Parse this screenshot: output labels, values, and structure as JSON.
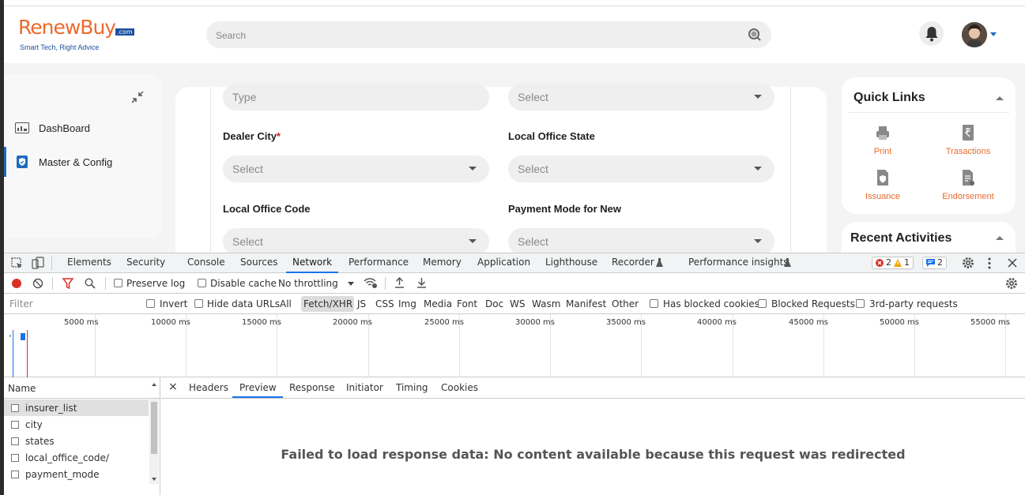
{
  "header": {
    "logo_main": "RenewBuy",
    "logo_dotcom": ".com",
    "logo_tagline": "Smart Tech, Right Advice",
    "search_placeholder": "Search",
    "brand_orange": "#ec6a2c",
    "brand_blue": "#1c4f9c"
  },
  "sidebar": {
    "items": [
      {
        "label": "DashBoard",
        "icon": "dashboard-icon"
      },
      {
        "label": "Master & Config",
        "icon": "shield-check-icon",
        "active": true
      }
    ]
  },
  "form": {
    "row1": {
      "left_placeholder": "Type",
      "right_placeholder": "Select"
    },
    "dealer_city_label": "Dealer City",
    "dealer_city_required": "*",
    "local_office_state_label": "Local Office State",
    "dealer_city_placeholder": "Select",
    "local_office_state_placeholder": "Select",
    "local_office_code_label": "Local Office Code",
    "payment_mode_label": "Payment Mode for New",
    "local_office_code_placeholder": "Select",
    "payment_mode_placeholder": "Select"
  },
  "quick_links": {
    "title": "Quick Links",
    "items": [
      {
        "label": "Print",
        "icon": "printer-icon"
      },
      {
        "label": "Trasactions",
        "icon": "rupee-document-icon"
      },
      {
        "label": "Issuance",
        "icon": "shield-document-icon"
      },
      {
        "label": "Endorsement",
        "icon": "edit-document-icon"
      }
    ]
  },
  "recent_activities": {
    "title": "Recent Activities"
  },
  "devtools": {
    "tabs": [
      "Elements",
      "Security",
      "Console",
      "Sources",
      "Network",
      "Performance",
      "Memory",
      "Application",
      "Lighthouse",
      "Recorder",
      "Performance insights"
    ],
    "active_tab": "Network",
    "errors": "2",
    "warnings": "1",
    "messages": "2",
    "toolbar": {
      "preserve_log": "Preserve log",
      "disable_cache": "Disable cache",
      "throttling": "No throttling"
    },
    "filter_bar": {
      "filter_placeholder": "Filter",
      "invert": "Invert",
      "hide_data_urls": "Hide data URLs",
      "types": [
        "All",
        "Fetch/XHR",
        "JS",
        "CSS",
        "Img",
        "Media",
        "Font",
        "Doc",
        "WS",
        "Wasm",
        "Manifest",
        "Other"
      ],
      "active_type": "Fetch/XHR",
      "has_blocked_cookies": "Has blocked cookies",
      "blocked_requests": "Blocked Requests",
      "third_party": "3rd-party requests"
    },
    "timeline_ticks": [
      "5000 ms",
      "10000 ms",
      "15000 ms",
      "20000 ms",
      "25000 ms",
      "30000 ms",
      "35000 ms",
      "40000 ms",
      "45000 ms",
      "50000 ms",
      "55000 ms"
    ],
    "requests": {
      "header": "Name",
      "rows": [
        "insurer_list",
        "city",
        "states",
        "local_office_code/",
        "payment_mode"
      ],
      "selected": "insurer_list"
    },
    "detail": {
      "close": "×",
      "tabs": [
        "Headers",
        "Preview",
        "Response",
        "Initiator",
        "Timing",
        "Cookies"
      ],
      "active_tab": "Preview",
      "message": "Failed to load response data: No content available because this request was redirected"
    }
  }
}
